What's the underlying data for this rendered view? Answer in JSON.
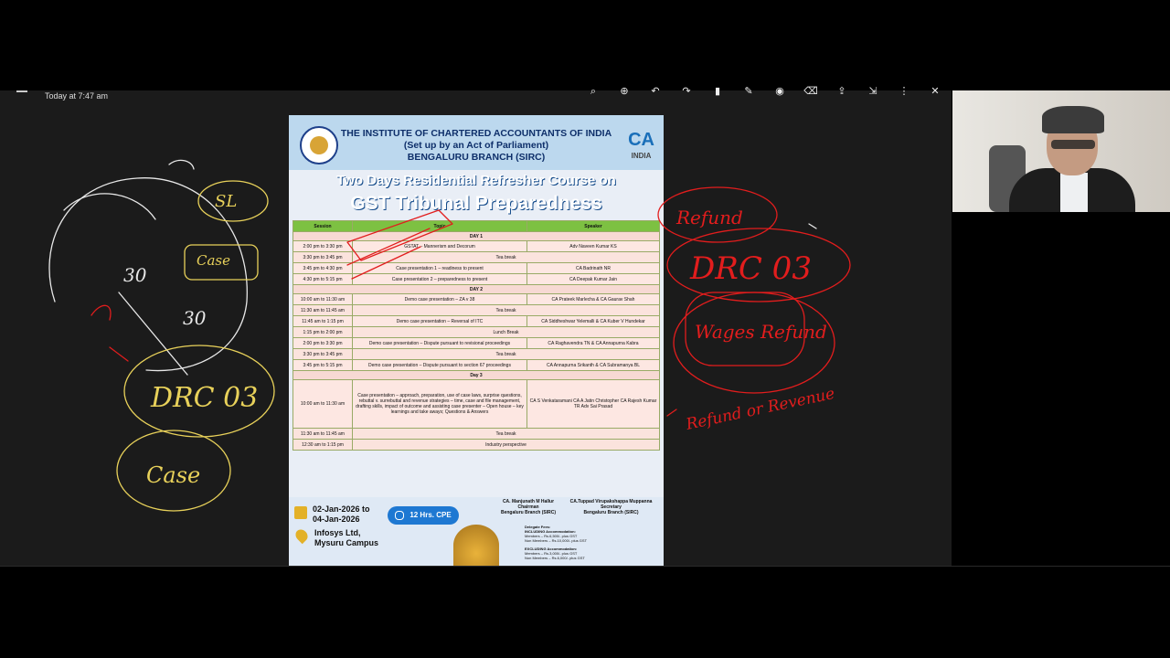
{
  "topbar": {
    "timestamp": "Today at 7:47 am"
  },
  "toolbar": {
    "icons": [
      "search-icon",
      "zoom-icon",
      "undo-icon",
      "redo-icon",
      "bookmark-icon",
      "pen-icon",
      "highlighter-icon",
      "eraser-icon",
      "share-icon",
      "export-icon",
      "more-icon",
      "close-icon"
    ]
  },
  "poster": {
    "org": "THE INSTITUTE OF CHARTERED ACCOUNTANTS OF INDIA",
    "subtitle": "(Set up by an Act of Parliament)",
    "branch": "BENGALURU BRANCH (SIRC)",
    "ca_logo_text": "CA",
    "ca_logo_sub": "INDIA",
    "banner1": "Two Days Residential Refresher Course on",
    "banner2": "GST Tribunal Preparedness",
    "columns": [
      "Session",
      "Topic",
      "Speaker"
    ],
    "rows": [
      {
        "type": "day",
        "text": "DAY 1"
      },
      {
        "type": "row",
        "time": "2:00 pm to 3:30 pm",
        "topic": "GSTAT – Mannerism and Decorum",
        "speaker": "Adv Naveen Kumar KS"
      },
      {
        "type": "brk",
        "time": "3:30 pm to 3:45 pm",
        "text": "Tea break"
      },
      {
        "type": "row",
        "time": "3:45 pm to 4:30 pm",
        "topic": "Case presentation 1 – readiness to present",
        "speaker": "CA Badrinath NR"
      },
      {
        "type": "row",
        "time": "4:30 pm to 5:15 pm",
        "topic": "Case presentation 2 – preparedness to present",
        "speaker": "CA Deepak Kumar Jain"
      },
      {
        "type": "day",
        "text": "DAY 2"
      },
      {
        "type": "row",
        "time": "10:00 am to 11:30 am",
        "topic": "Demo case presentation – ZA v 38",
        "speaker": "CA Prateek Marlecha & CA Gaurav Shah"
      },
      {
        "type": "brk",
        "time": "11:30 am to 11:45 am",
        "text": "Tea break"
      },
      {
        "type": "row",
        "time": "11:45 am to 1:15 pm",
        "topic": "Demo case presentation – Reversal of ITC",
        "speaker": "CA Siddheshwar Yelemalli & CA Kuber V Hundekar"
      },
      {
        "type": "brk",
        "time": "1:15 pm to 2:00 pm",
        "text": "Lunch Break"
      },
      {
        "type": "row",
        "time": "2:00 pm to 3:30 pm",
        "topic": "Demo case presentation – Dispute pursuant to revisional proceedings",
        "speaker": "CA Raghavendra TN & CA Annapurna Kabra"
      },
      {
        "type": "brk",
        "time": "3:30 pm to 3:45 pm",
        "text": "Tea break"
      },
      {
        "type": "row",
        "time": "3:45 pm to 5:15 pm",
        "topic": "Demo case presentation – Dispute pursuant to section 67 proceedings",
        "speaker": "CA Annapurna Srikanth & CA Subramanya BL"
      },
      {
        "type": "day",
        "text": "Day 3"
      },
      {
        "type": "big",
        "time": "10:00 am to 11:30 am",
        "topic": "Case presentation – approach, preparation, use of case laws, surprise questions, rebuttal v. surrebuttal and revenue strategies – time, case and file management, drafting skills, impact of outcome and assisting case presenter – Open house – key learnings and take aways; Questions & Answers",
        "speaker": "CA S Venkataramani CA A Jatin Christopher CA Rajesh Kumar TR Adv Sai Prasad"
      },
      {
        "type": "brk",
        "time": "11:30 am to 11:45 am",
        "text": "Tea break"
      },
      {
        "type": "brk",
        "time": "12:30 am to 1:15 pm",
        "text": "Industry perspective"
      }
    ],
    "date": "02-Jan-2026 to 04-Jan-2026",
    "date_line1": "02-Jan-2026 to",
    "date_line2": "04-Jan-2026",
    "venue_line1": "Infosys Ltd,",
    "venue_line2": "Mysuru Campus",
    "cpe": "12 Hrs. CPE",
    "sign1_name": "CA. Manjunath M Hallur",
    "sign1_role": "Chairman",
    "sign1_branch": "Bengaluru Branch (SIRC)",
    "sign2_name": "CA.Tuppad Virupakshappa Muppanna",
    "sign2_role": "Secretary",
    "sign2_branch": "Bengaluru Branch (SIRC)",
    "fees_title": "Delegate Fees:",
    "fees_inc": "INCLUDING Accommodation:",
    "fees_inc_m": "Members – Rs.6,500/- plus GST",
    "fees_inc_n": "Non Members – Rs.10,000/- plus GST",
    "fees_exc": "EXCLUDING Accommodation:",
    "fees_exc_m": "Members – Rs.3,000/- plus GST",
    "fees_exc_n": "Non Members – Rs.6,000/- plus GST"
  },
  "annotations": {
    "left": [
      "SL",
      "30",
      "30",
      "DRC 03",
      "Case"
    ],
    "right": [
      "Refund",
      "DRC 03",
      "Wages Refund",
      "Refund or Revenue"
    ]
  },
  "colors": {
    "ink_yellow": "#e8d15a",
    "ink_red": "#e21d1d",
    "ink_white": "#e8e8e8",
    "table_header": "#7dc142"
  }
}
